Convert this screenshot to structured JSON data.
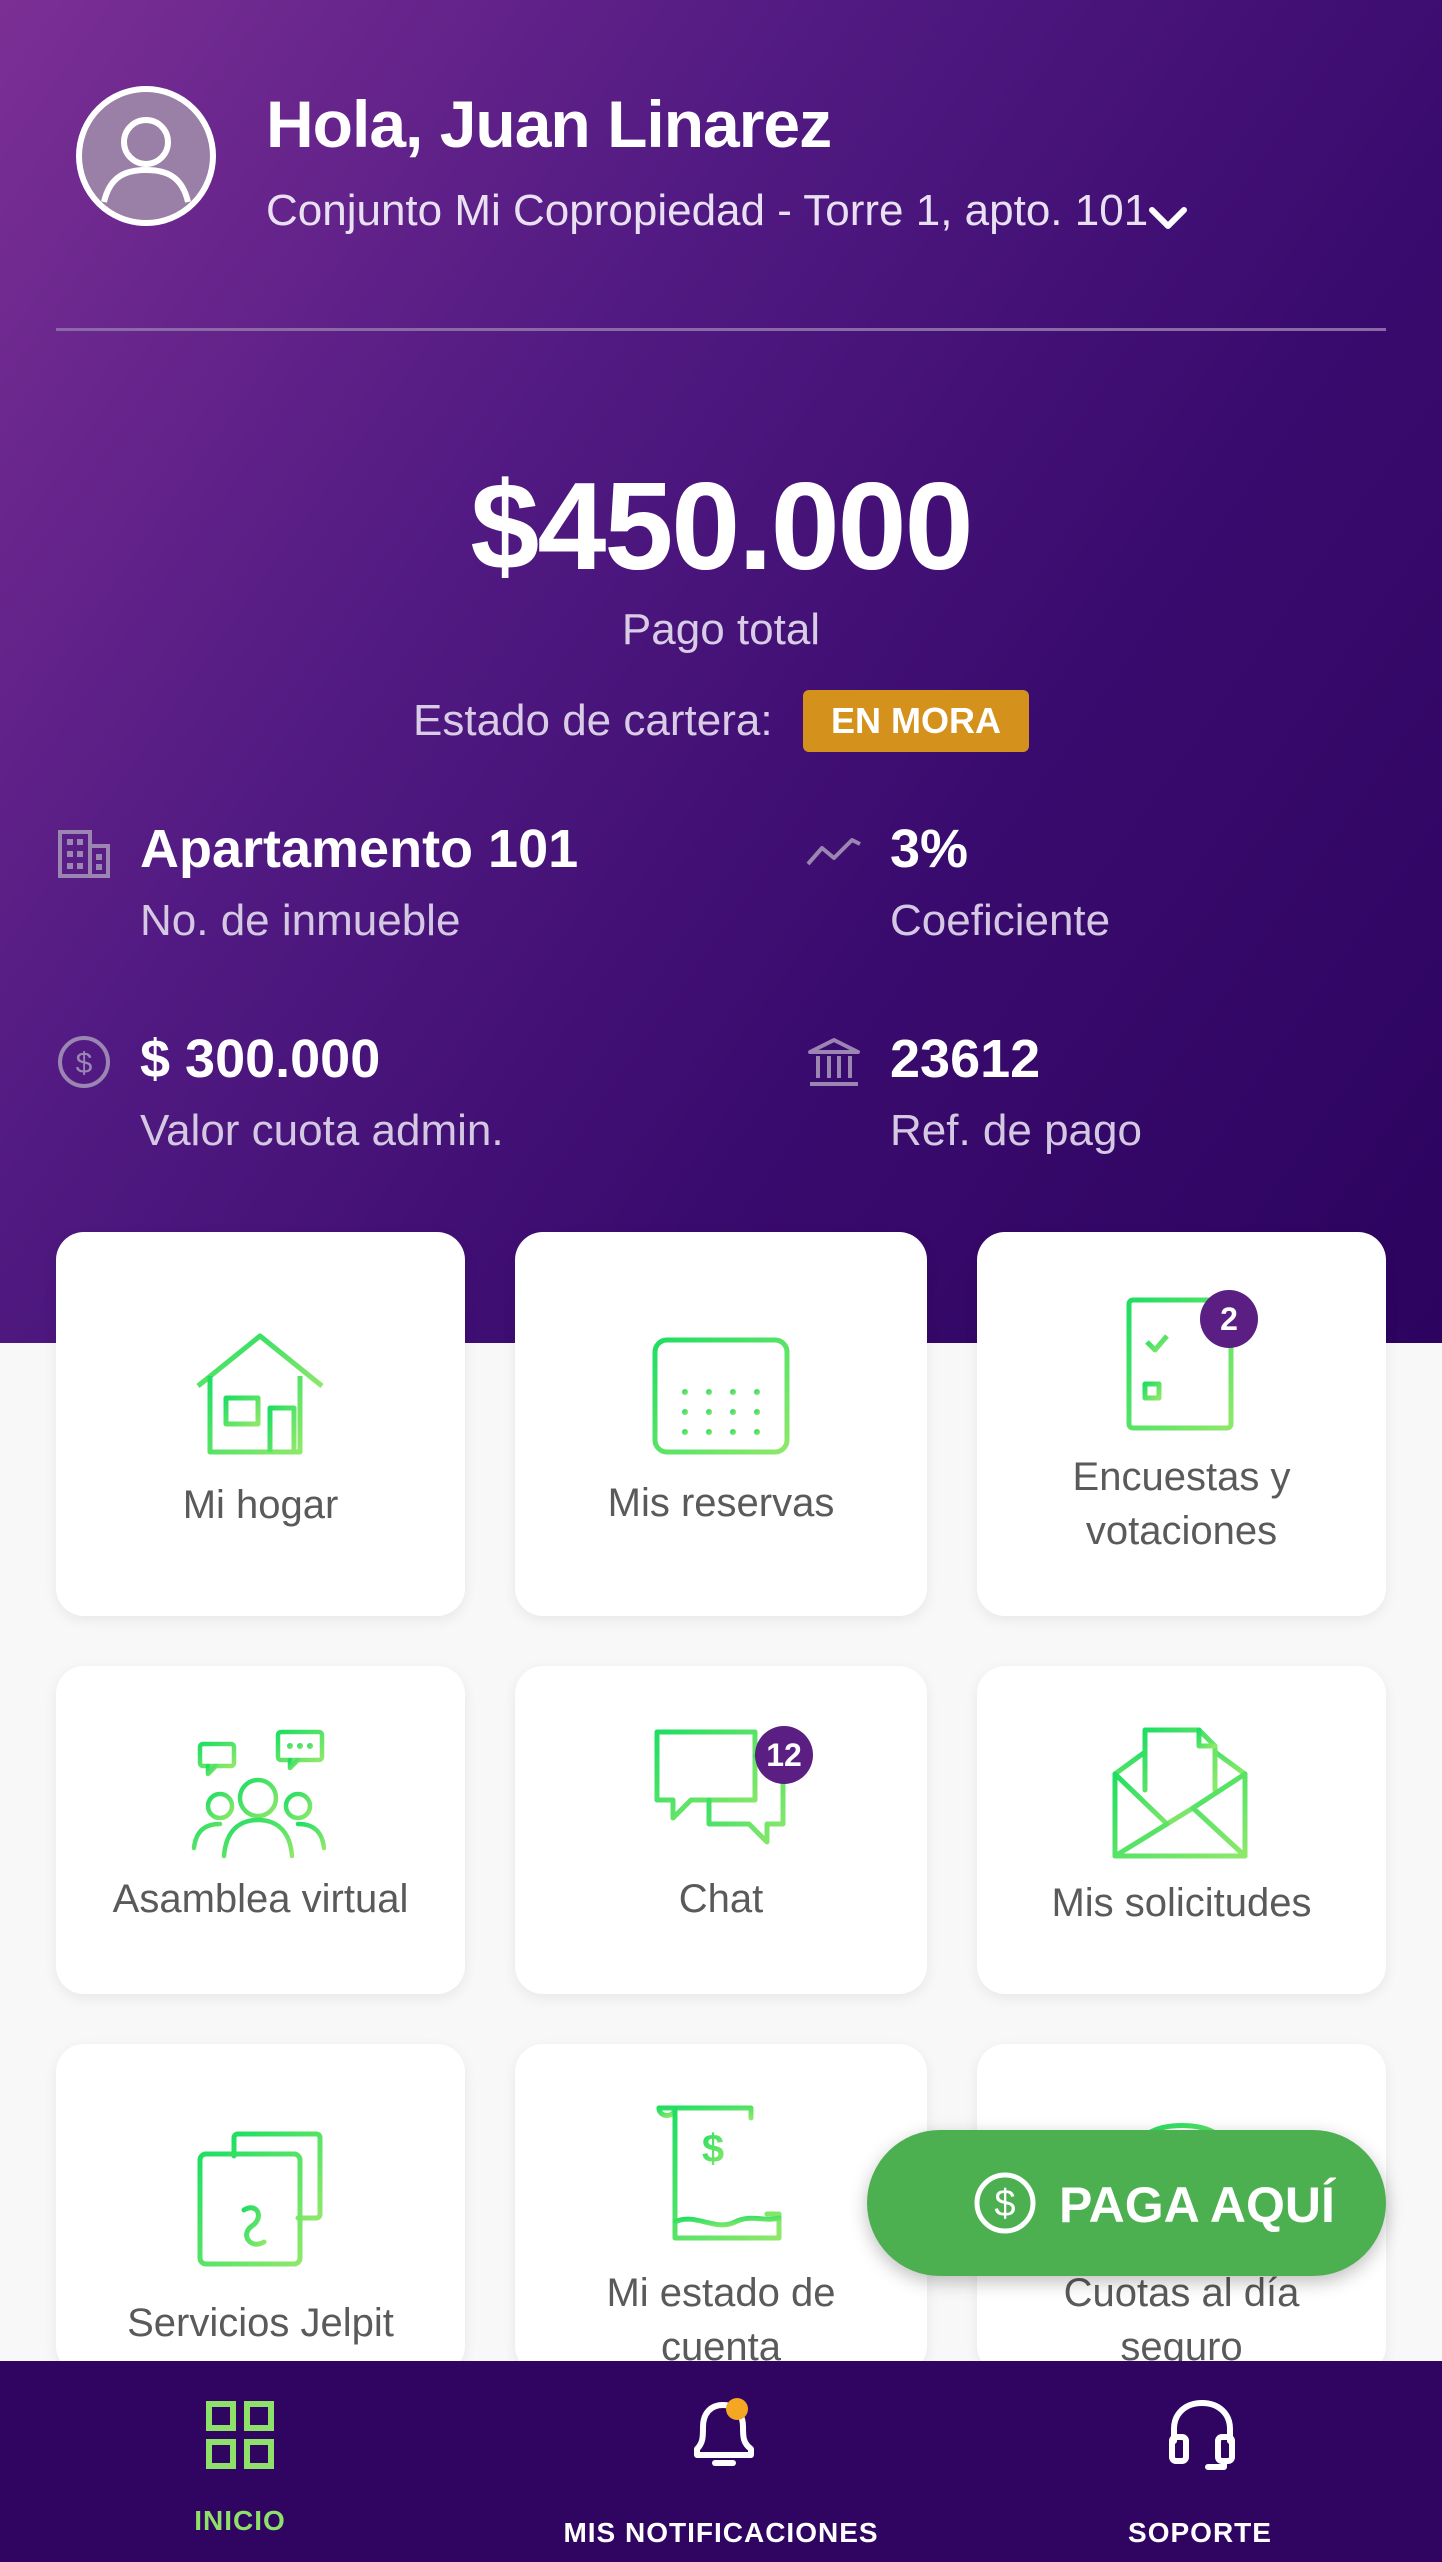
{
  "colors": {
    "hero_start": "#7b2f95",
    "hero_end": "#2c035f",
    "accent_green": "#4caf50",
    "icon_green": "#2ee06a",
    "badge_purple": "#5b1e82",
    "status_orange": "#d4921d",
    "nav_bg": "#2f0561",
    "nav_active": "#8ee06a"
  },
  "header": {
    "avatar_icon": "user-avatar-icon",
    "greeting": "Hola, Juan Linarez",
    "address": "Conjunto Mi Copropiedad - Torre 1, apto. 101",
    "chevron_icon": "chevron-down-icon"
  },
  "summary": {
    "total_amount": "$450.000",
    "total_label": "Pago total",
    "estado_label": "Estado de cartera:",
    "estado_badge": "EN MORA"
  },
  "info": [
    {
      "icon": "building-icon",
      "value": "Apartamento 101",
      "label": "No. de inmueble"
    },
    {
      "icon": "trend-icon",
      "value": "3%",
      "label": "Coeficiente"
    },
    {
      "icon": "dollar-circle-icon",
      "value": "$ 300.000",
      "label": "Valor cuota admin."
    },
    {
      "icon": "bank-icon",
      "value": "23612",
      "label": "Ref. de pago"
    }
  ],
  "menu": [
    {
      "icon": "house-icon",
      "label": "Mi hogar"
    },
    {
      "icon": "calendar-icon",
      "label": "Mis reservas"
    },
    {
      "icon": "survey-icon",
      "label": "Encuestas y votaciones",
      "badge": "2"
    },
    {
      "icon": "assembly-icon",
      "label": "Asamblea virtual"
    },
    {
      "icon": "chat-icon",
      "label": "Chat",
      "badge": "12"
    },
    {
      "icon": "envelope-icon",
      "label": "Mis solicitudes"
    },
    {
      "icon": "services-icon",
      "label": "Servicios Jelpit"
    },
    {
      "icon": "receipt-icon",
      "label": "Mi estado de cuenta"
    },
    {
      "icon": "umbrella-icon",
      "label": "Cuotas al día seguro"
    }
  ],
  "pay_button": {
    "icon": "dollar-circle-icon",
    "label": "PAGA AQUÍ"
  },
  "bottom_nav": [
    {
      "icon": "grid-icon",
      "label": "INICIO",
      "active": true
    },
    {
      "icon": "bell-icon",
      "label": "MIS NOTIFICACIONES",
      "active": false
    },
    {
      "icon": "headset-icon",
      "label": "SOPORTE",
      "active": false
    }
  ]
}
